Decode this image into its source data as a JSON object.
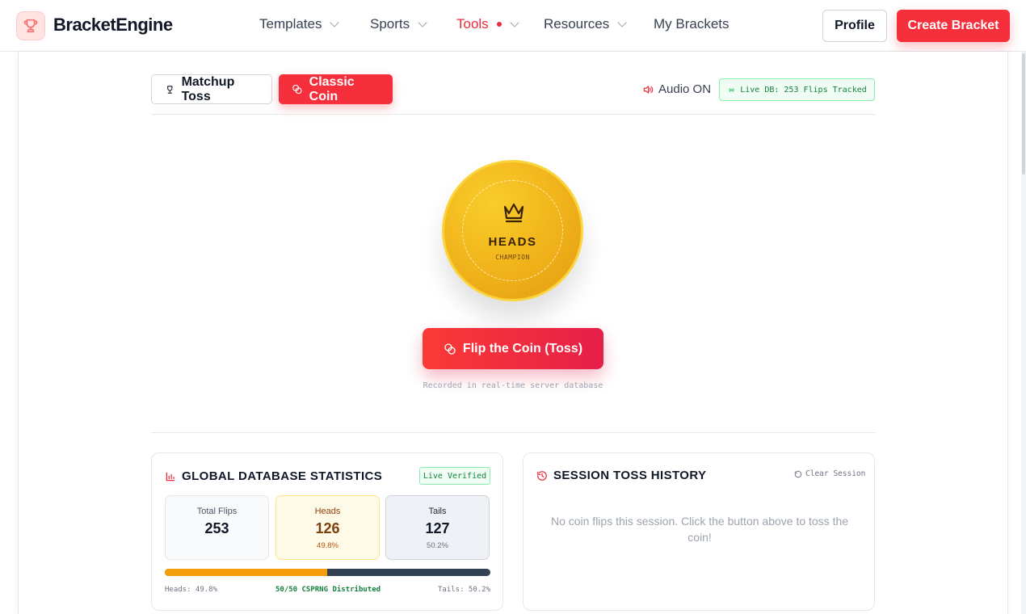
{
  "header": {
    "brand": "BracketEngine",
    "nav": [
      {
        "label": "Templates"
      },
      {
        "label": "Sports"
      },
      {
        "label": "Tools"
      },
      {
        "label": "Resources"
      },
      {
        "label": "My Brackets"
      }
    ],
    "profile_label": "Profile",
    "create_label": "Create Bracket",
    "active_color": "#ef2b3a"
  },
  "tabs": [
    {
      "label": "Matchup Toss"
    },
    {
      "label": "Classic Coin"
    }
  ],
  "audio_label": "Audio ON",
  "live_db_label": "Live DB: 253 Flips Tracked",
  "coin": {
    "face": "HEADS",
    "subtitle": "CHAMPION"
  },
  "flip_button_label": "Flip the Coin (Toss)",
  "recorded_note": "Recorded in real-time server database",
  "stats": {
    "title": "GLOBAL DATABASE STATISTICS",
    "badge": "Live Verified",
    "total": {
      "label": "Total Flips",
      "value": "253"
    },
    "heads": {
      "label": "Heads",
      "value": "126",
      "pct": "49.8%"
    },
    "tails": {
      "label": "Tails",
      "value": "127",
      "pct": "50.2%"
    },
    "heads_fraction": 0.498,
    "bar_left": "Heads: 49.8%",
    "bar_mid": "50/50 CSPRNG Distributed",
    "bar_right": "Tails: 50.2%"
  },
  "history": {
    "title": "SESSION TOSS HISTORY",
    "clear_label": "Clear Session",
    "empty_text": "No coin flips this session. Click the button above to toss the coin!"
  }
}
